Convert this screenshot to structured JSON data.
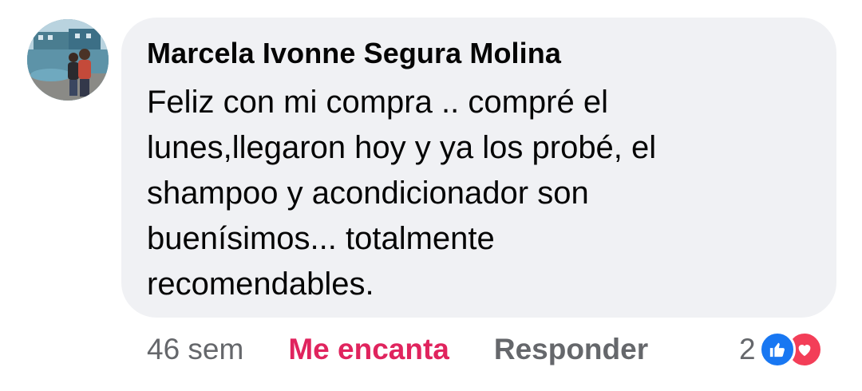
{
  "comment": {
    "author": "Marcela Ivonne Segura Molina",
    "text_lines": [
      "Feliz con mi compra .. compré el",
      "lunes,llegaron hoy y ya los probé, el",
      "shampoo y acondicionador son",
      "buenísimos... totalmente",
      "recomendables."
    ]
  },
  "actions": {
    "time": "46 sem",
    "reaction_label": "Me encanta",
    "reply_label": "Responder"
  },
  "reactions": {
    "count": "2",
    "icons": [
      "like-icon",
      "love-icon"
    ]
  },
  "colors": {
    "bubble": "#f0f1f4",
    "love_red": "#e0245e",
    "like_blue": "#1877f2",
    "secondary_text": "#65676b"
  }
}
